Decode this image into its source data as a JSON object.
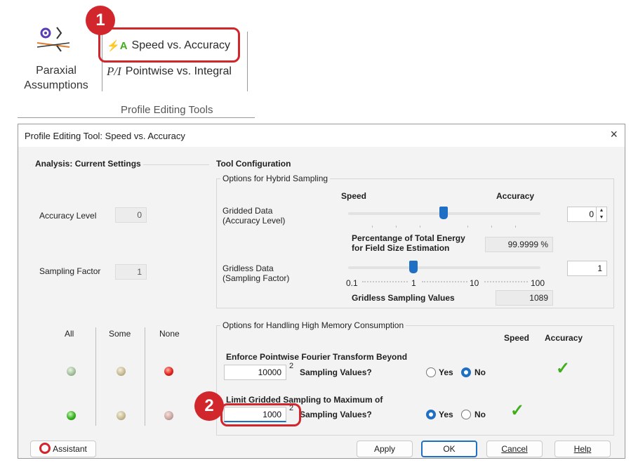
{
  "ribbon": {
    "paraxial_label_line1": "Paraxial",
    "paraxial_label_line2": "Assumptions",
    "speed_accuracy_label": "Speed vs. Accuracy",
    "pointwise_integral_label": "Pointwise vs. Integral",
    "pointwise_icon_text": "P/I",
    "group_label": "Profile Editing Tools"
  },
  "callouts": {
    "one": "1",
    "two": "2"
  },
  "dialog": {
    "title": "Profile Editing Tool: Speed vs. Accuracy",
    "close_icon": "×",
    "analysis": {
      "header": "Analysis: Current Settings",
      "accuracy_level_label": "Accuracy Level",
      "accuracy_level_value": "0",
      "sampling_factor_label": "Sampling Factor",
      "sampling_factor_value": "1",
      "col_all": "All",
      "col_some": "Some",
      "col_none": "None"
    },
    "tool_config": {
      "header": "Tool Configuration",
      "hybrid": {
        "header": "Options for Hybrid Sampling",
        "speed_label": "Speed",
        "accuracy_label": "Accuracy",
        "gridded_label_1": "Gridded Data",
        "gridded_label_2": "(Accuracy Level)",
        "gridded_value": "0",
        "gridded_slider_fraction": 0.5,
        "energy_label_1": "Percentange of Total Energy",
        "energy_label_2": "for Field Size Estimation",
        "energy_value": "99.9999 %",
        "gridless_label_1": "Gridless Data",
        "gridless_label_2": "(Sampling Factor)",
        "gridless_value": "1",
        "scale_ticks": [
          "0.1",
          "1",
          "10",
          "100"
        ],
        "gridless_values_label": "Gridless Sampling Values",
        "gridless_values_value": "1089"
      },
      "memory": {
        "header": "Options for Handling High Memory Consumption",
        "speed_label": "Speed",
        "accuracy_label": "Accuracy",
        "enforce_label": "Enforce Pointwise Fourier Transform Beyond",
        "enforce_value": "10000",
        "enforce_sup": "2",
        "enforce_suffix": "Sampling Values?",
        "enforce_yes": "Yes",
        "enforce_no": "No",
        "enforce_selected": "No",
        "limit_label": "Limit Gridded Sampling to Maximum of",
        "limit_value": "1000",
        "limit_sup": "2",
        "limit_suffix": "Sampling Values?",
        "limit_yes": "Yes",
        "limit_no": "No",
        "limit_selected": "Yes",
        "checkmark": "✓"
      }
    },
    "buttons": {
      "assistant": "Assistant",
      "apply": "Apply",
      "ok": "OK",
      "cancel": "Cancel",
      "help": "Help"
    }
  },
  "colors": {
    "accent": "#1f6fc5",
    "callout_red": "#d0262c",
    "check_green": "#3fae1c"
  }
}
